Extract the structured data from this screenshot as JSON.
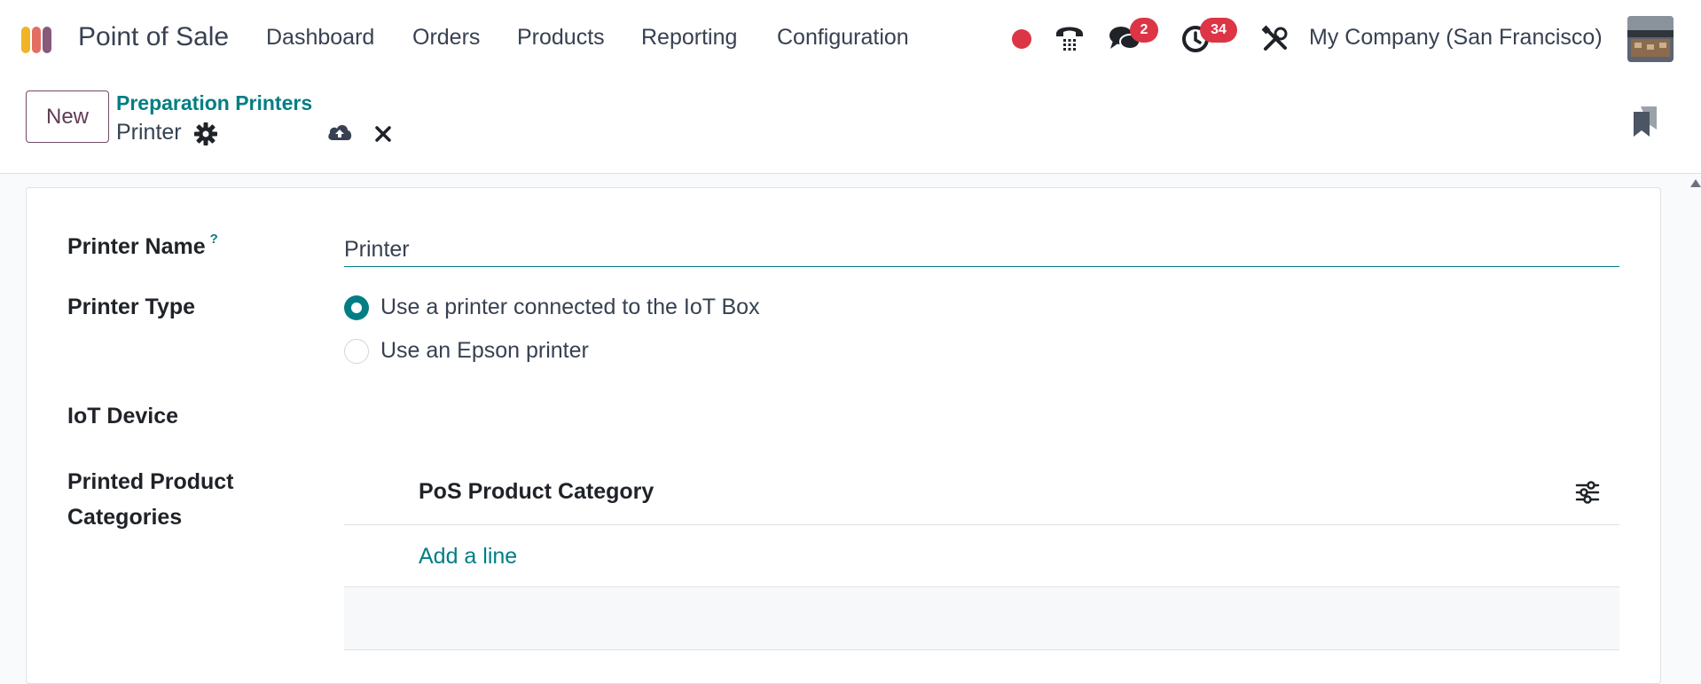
{
  "navbar": {
    "app_name": "Point of Sale",
    "menu": [
      "Dashboard",
      "Orders",
      "Products",
      "Reporting",
      "Configuration"
    ],
    "messages_count": "2",
    "activities_count": "34",
    "company": "My Company (San Francisco)",
    "icons": [
      "status-dot-icon",
      "phone-icon",
      "chat-icon",
      "clock-icon",
      "tools-icon"
    ]
  },
  "control_panel": {
    "new_label": "New",
    "breadcrumb_parent": "Preparation Printers",
    "record_name": "Printer"
  },
  "form": {
    "printer_name_label": "Printer Name",
    "help_mark": "?",
    "printer_name_value": "Printer",
    "printer_type_label": "Printer Type",
    "printer_type_options": [
      {
        "label": "Use a printer connected to the IoT Box",
        "checked": true
      },
      {
        "label": "Use an Epson printer",
        "checked": false
      }
    ],
    "iot_device_label": "IoT Device",
    "categories_label_line1": "Printed Product",
    "categories_label_line2": "Categories",
    "categories_column": "PoS Product Category",
    "add_line": "Add a line"
  },
  "colors": {
    "accent": "#017e84",
    "brand": "#714b67",
    "badge": "#dc3545",
    "status_dot": "#dc3545"
  }
}
